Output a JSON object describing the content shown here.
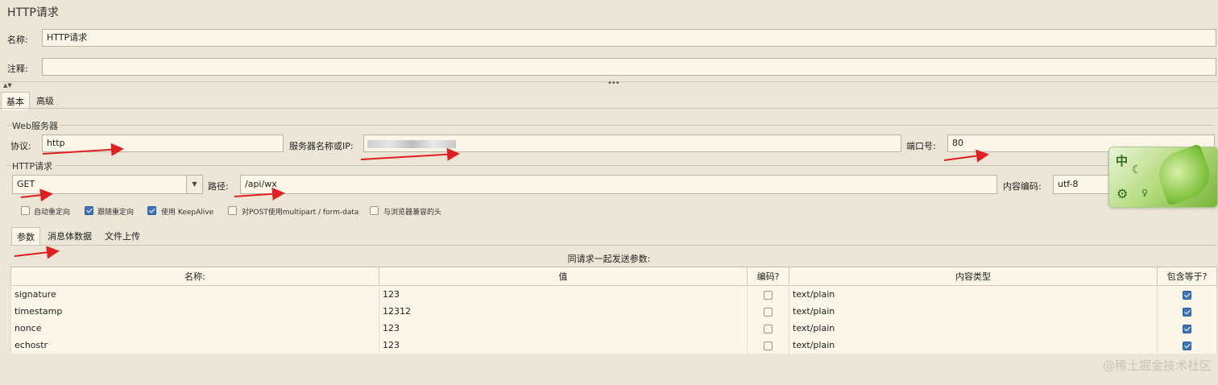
{
  "title": "HTTP请求",
  "name_label": "名称:",
  "name_value": "HTTP请求",
  "comment_label": "注释:",
  "comment_value": "",
  "tabs": [
    "基本",
    "高级"
  ],
  "web_server": {
    "group_title": "Web服务器",
    "protocol_label": "协议:",
    "protocol_value": "http",
    "server_label": "服务器名称或IP:",
    "server_value": "",
    "port_label": "端口号:",
    "port_value": "80"
  },
  "http_request": {
    "group_title": "HTTP请求",
    "method": "GET",
    "path_label": "路径:",
    "path_value": "/api/wx",
    "encoding_label": "内容编码:",
    "encoding_value": "utf-8"
  },
  "options": [
    {
      "label": "自动重定向",
      "checked": false
    },
    {
      "label": "跟随重定向",
      "checked": true
    },
    {
      "label": "使用 KeepAlive",
      "checked": true
    },
    {
      "label": "对POST使用multipart / form-data",
      "checked": false
    },
    {
      "label": "与浏览器兼容的头",
      "checked": false
    }
  ],
  "sub_tabs": [
    "参数",
    "消息体数据",
    "文件上传"
  ],
  "params_caption": "同请求一起发送参数:",
  "table": {
    "headers": [
      "名称:",
      "值",
      "编码?",
      "内容类型",
      "包含等于?"
    ],
    "rows": [
      {
        "name": "signature",
        "value": "123",
        "encode": false,
        "content_type": "text/plain",
        "include_equals": true
      },
      {
        "name": "timestamp",
        "value": "12312",
        "encode": false,
        "content_type": "text/plain",
        "include_equals": true
      },
      {
        "name": "nonce",
        "value": "123",
        "encode": false,
        "content_type": "text/plain",
        "include_equals": true
      },
      {
        "name": "echostr",
        "value": "123",
        "encode": false,
        "content_type": "text/plain",
        "include_equals": true
      }
    ]
  },
  "ime_label": "中",
  "watermark": "@稀土掘金技术社区",
  "arrow_color": "#e02020"
}
